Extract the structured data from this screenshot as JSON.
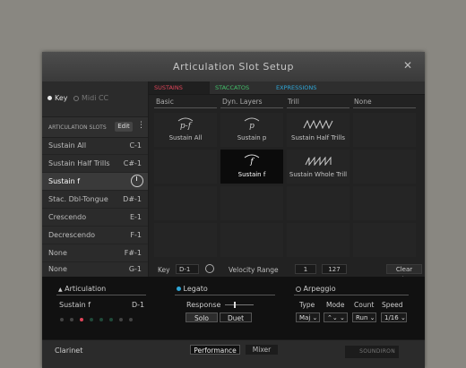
{
  "window": {
    "title": "Articulation Slot Setup"
  },
  "mode": {
    "key_label": "Key",
    "midicc_label": "Midi CC"
  },
  "slots": {
    "header": "ARTICULATION SLOTS",
    "edit_label": "Edit",
    "items": [
      {
        "name": "Sustain All",
        "key": "C-1"
      },
      {
        "name": "Sustain Half Trills",
        "key": "C#-1"
      },
      {
        "name": "Sustain f",
        "key": ""
      },
      {
        "name": "Stac. Dbl-Tongue",
        "key": "D#-1"
      },
      {
        "name": "Crescendo",
        "key": "E-1"
      },
      {
        "name": "Decrescendo",
        "key": "F-1"
      },
      {
        "name": "None",
        "key": "F#-1"
      },
      {
        "name": "None",
        "key": "G-1"
      }
    ]
  },
  "tabs": [
    {
      "label": "SUSTAINS",
      "color": "#e0455a"
    },
    {
      "label": "STACCATOS",
      "color": "#43c06b"
    },
    {
      "label": "EXPRESSIONS",
      "color": "#2fa7d8"
    }
  ],
  "columns": [
    "Basic",
    "Dyn. Layers",
    "Trill",
    "None"
  ],
  "grid": {
    "sustain_all": {
      "glyph": "p-f",
      "label": "Sustain All"
    },
    "sustain_p": {
      "glyph": "p",
      "label": "Sustain p"
    },
    "sustain_half_trills": {
      "label": "Sustain Half Trills"
    },
    "sustain_f": {
      "glyph": "f",
      "label": "Sustain f"
    },
    "sustain_whole_trill": {
      "label": "Sustain Whole Trill"
    }
  },
  "keybar": {
    "key_label": "Key",
    "key_value": "D-1",
    "velocity_label": "Velocity Range",
    "vel_min": "1",
    "vel_max": "127",
    "clear_label": "Clear Slot"
  },
  "articulation": {
    "title": "Articulation",
    "current": "Sustain f",
    "key": "D-1"
  },
  "legato": {
    "title": "Legato",
    "response_label": "Response",
    "solo": "Solo",
    "duet": "Duet"
  },
  "arpeggio": {
    "title": "Arpeggio",
    "type_label": "Type",
    "mode_label": "Mode",
    "count_label": "Count",
    "speed_label": "Speed",
    "type_value": "Maj",
    "mode_value": "⌃⌄",
    "count_value": "Run",
    "speed_value": "1/16"
  },
  "footer": {
    "instrument": "Clarinet",
    "performance": "Performance",
    "mixer": "Mixer",
    "brand": "SOUNDIRON"
  }
}
